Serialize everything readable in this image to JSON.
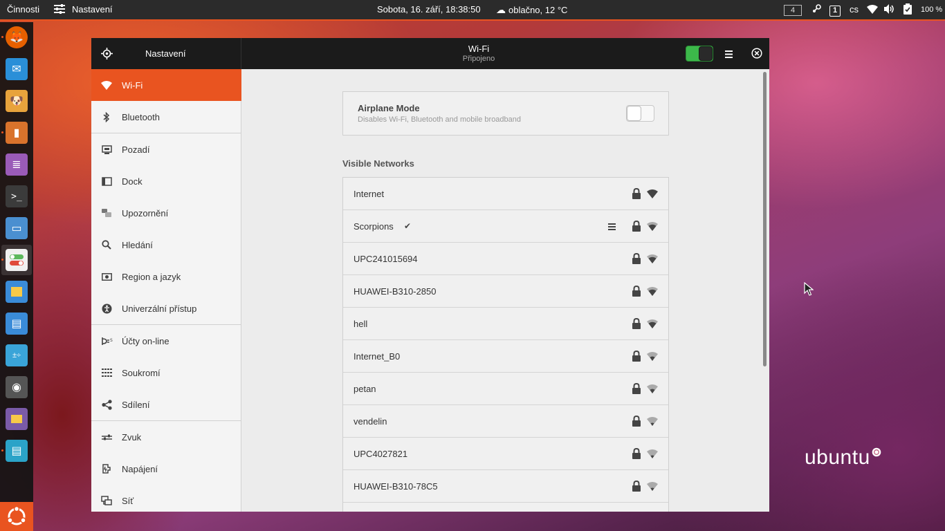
{
  "topbar": {
    "activities": "Činnosti",
    "app_menu": "Nastavení",
    "clock": "Sobota, 16. září, 18:38:50",
    "weather": "oblačno, 12 °C",
    "workspace": "4",
    "notif_count": "1",
    "keyboard": "cs",
    "battery": "100 %"
  },
  "dock": {
    "apps": [
      "firefox-icon",
      "mail-icon",
      "gimp-icon",
      "speaker-icon",
      "text-editor-icon",
      "terminal-icon",
      "remote-desktop-icon",
      "settings-icon",
      "notes-icon",
      "disk-icon",
      "calculator-icon",
      "webcam-icon",
      "files-icon",
      "document-viewer-icon"
    ]
  },
  "window": {
    "sidebar_title": "Nastavení",
    "title": "Wi-Fi",
    "subtitle": "Připojeno"
  },
  "sidebar": {
    "items": [
      {
        "label": "Wi-Fi"
      },
      {
        "label": "Bluetooth"
      },
      {
        "label": "Pozadí"
      },
      {
        "label": "Dock"
      },
      {
        "label": "Upozornění"
      },
      {
        "label": "Hledání"
      },
      {
        "label": "Region a jazyk"
      },
      {
        "label": "Univerzální přístup"
      },
      {
        "label": "Účty on-line"
      },
      {
        "label": "Soukromí"
      },
      {
        "label": "Sdílení"
      },
      {
        "label": "Zvuk"
      },
      {
        "label": "Napájení"
      },
      {
        "label": "Síť"
      }
    ]
  },
  "airplane": {
    "title": "Airplane Mode",
    "description": "Disables Wi-Fi, Bluetooth and mobile broadband"
  },
  "networks": {
    "heading": "Visible Networks",
    "items": [
      {
        "name": "Internet"
      },
      {
        "name": "Scorpions"
      },
      {
        "name": "UPC241015694"
      },
      {
        "name": "HUAWEI-B310-2850"
      },
      {
        "name": "hell"
      },
      {
        "name": "Internet_B0"
      },
      {
        "name": "petan"
      },
      {
        "name": "vendelin"
      },
      {
        "name": "UPC4027821"
      },
      {
        "name": "HUAWEI-B310-78C5"
      }
    ]
  },
  "desktop": {
    "brand": "ubuntu"
  }
}
